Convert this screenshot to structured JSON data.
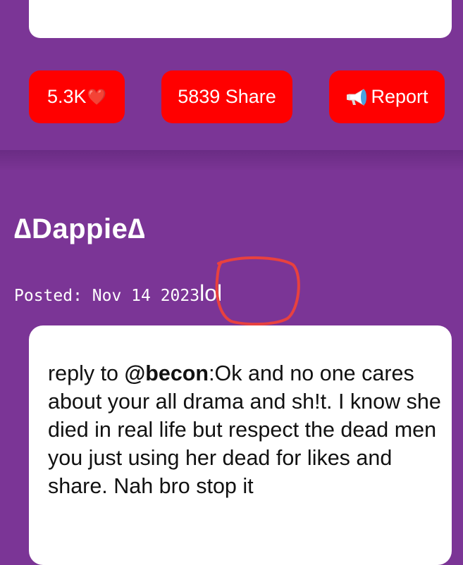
{
  "actions": {
    "like_count": "5.3K",
    "like_icon": "❤️",
    "share_label": "5839 Share",
    "report_label": "Report"
  },
  "post": {
    "username": "∆Dappie∆",
    "posted_meta": "Posted: Nov 14 2023",
    "posted_suffix": "lol",
    "comment": {
      "reply_prefix": "reply to ",
      "mention": "@becon",
      "text": ":Ok and no one cares about your all drama and sh!t. I know she died in real life but respect the dead men you just using her dead for likes and share. Nah bro stop it"
    }
  },
  "colors": {
    "background": "#7b3596",
    "button": "#ff0000",
    "card": "#ffffff",
    "annotation": "#e8413f"
  }
}
